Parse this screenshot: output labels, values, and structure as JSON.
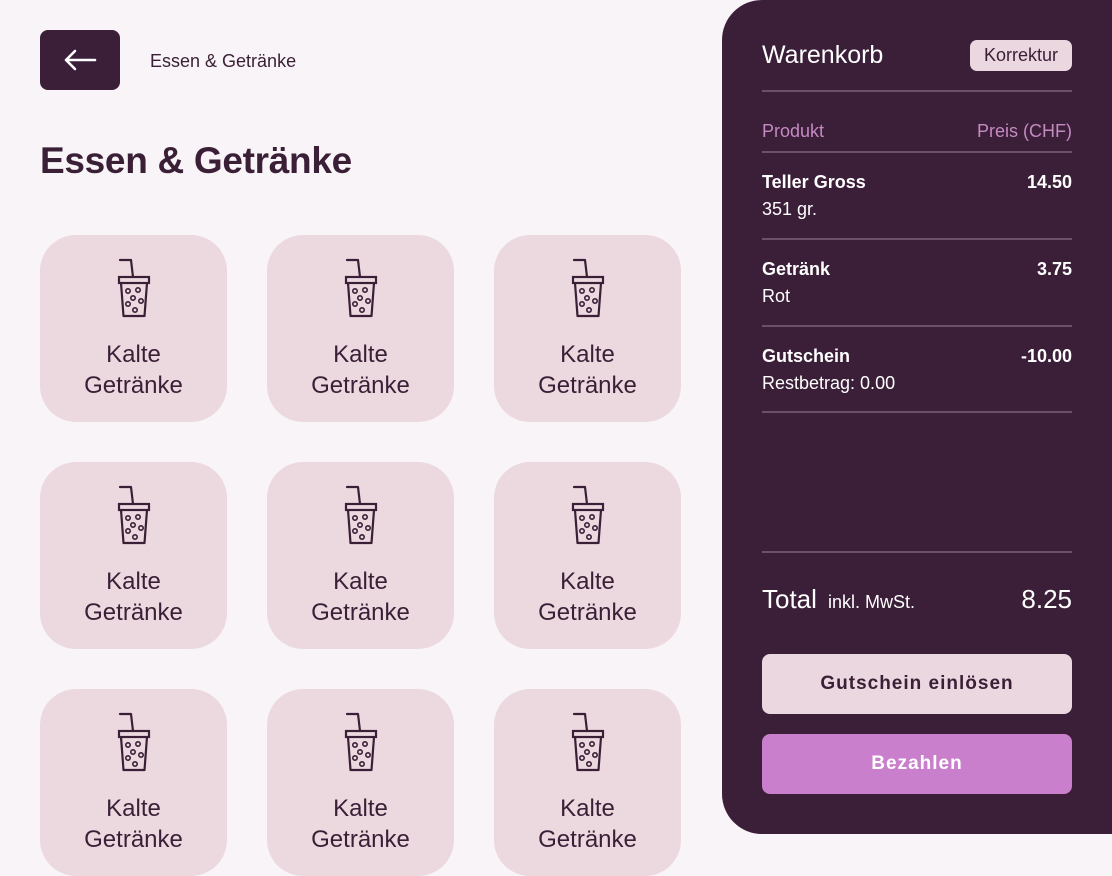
{
  "header": {
    "breadcrumb": "Essen & Getränke",
    "back_icon": "arrow-left-icon"
  },
  "page": {
    "title": "Essen & Getränke"
  },
  "tiles": [
    {
      "label_line1": "Kalte",
      "label_line2": "Getränke",
      "icon": "cup-with-straw-icon"
    },
    {
      "label_line1": "Kalte",
      "label_line2": "Getränke",
      "icon": "cup-with-straw-icon"
    },
    {
      "label_line1": "Kalte",
      "label_line2": "Getränke",
      "icon": "cup-with-straw-icon"
    },
    {
      "label_line1": "Kalte",
      "label_line2": "Getränke",
      "icon": "cup-with-straw-icon"
    },
    {
      "label_line1": "Kalte",
      "label_line2": "Getränke",
      "icon": "cup-with-straw-icon"
    },
    {
      "label_line1": "Kalte",
      "label_line2": "Getränke",
      "icon": "cup-with-straw-icon"
    },
    {
      "label_line1": "Kalte",
      "label_line2": "Getränke",
      "icon": "cup-with-straw-icon"
    },
    {
      "label_line1": "Kalte",
      "label_line2": "Getränke",
      "icon": "cup-with-straw-icon"
    },
    {
      "label_line1": "Kalte",
      "label_line2": "Getränke",
      "icon": "cup-with-straw-icon"
    }
  ],
  "cart": {
    "title": "Warenkorb",
    "correction_label": "Korrektur",
    "col_product": "Produkt",
    "col_price": "Preis (CHF)",
    "items": [
      {
        "name": "Teller Gross",
        "detail": "351 gr.",
        "price": "14.50"
      },
      {
        "name": "Getränk",
        "detail": "Rot",
        "price": "3.75"
      },
      {
        "name": "Gutschein",
        "detail": "Restbetrag: 0.00",
        "price": "-10.00"
      }
    ],
    "total_label": "Total",
    "total_note": "inkl. MwSt.",
    "total_value": "8.25",
    "voucher_button": "Gutschein einlösen",
    "pay_button": "Bezahlen"
  },
  "colors": {
    "background": "#f8f4f7",
    "dark": "#3b1e38",
    "tile": "#ecd9e0",
    "accent": "#c97fcb",
    "muted_header": "#c48ac2"
  }
}
